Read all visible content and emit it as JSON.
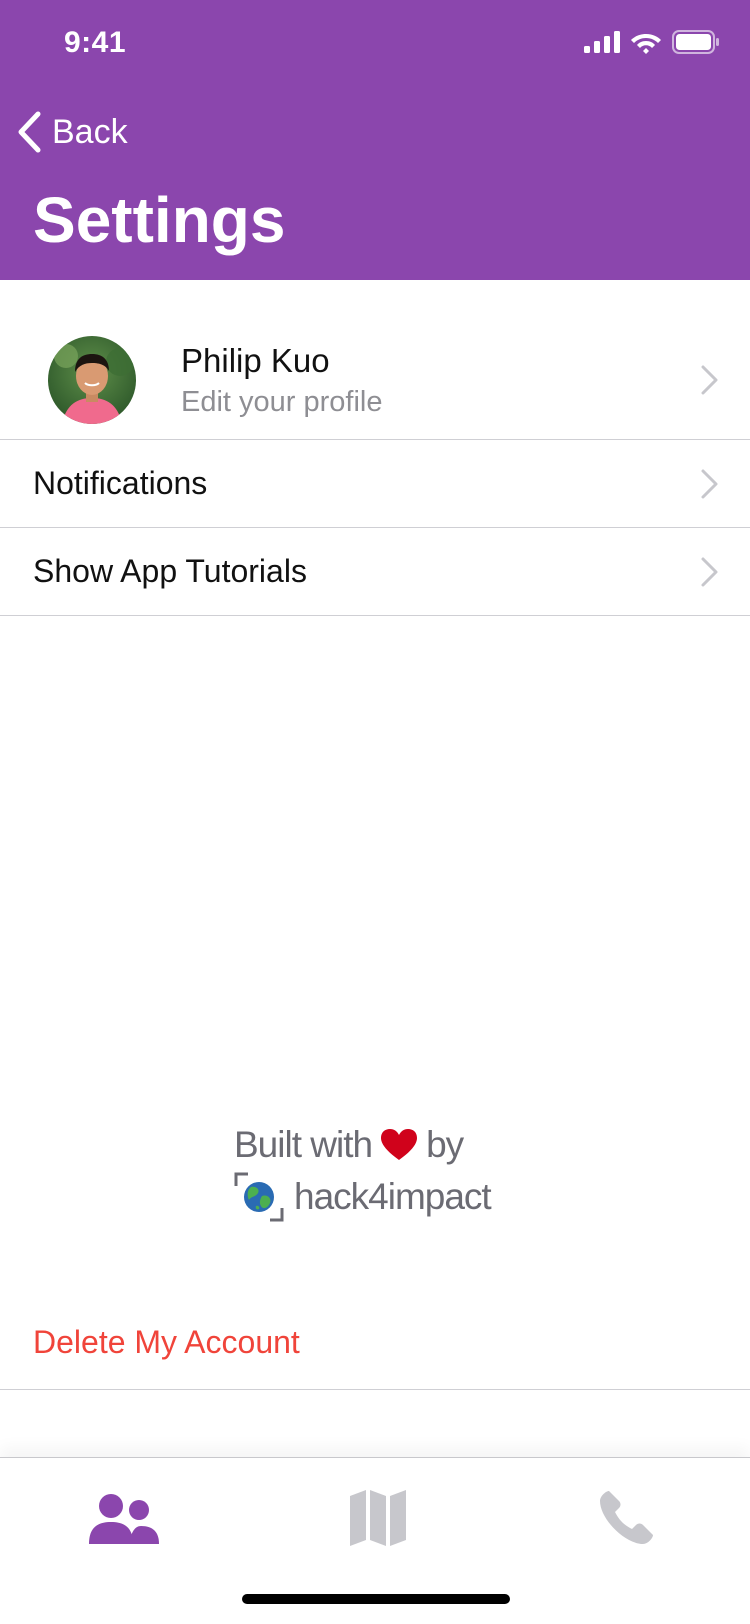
{
  "status_bar": {
    "time": "9:41"
  },
  "header": {
    "back_label": "Back",
    "title": "Settings",
    "background": "#8b46ad"
  },
  "profile": {
    "name": "Philip Kuo",
    "subtitle": "Edit your profile"
  },
  "menu": {
    "items": [
      {
        "label": "Notifications"
      },
      {
        "label": "Show App Tutorials"
      }
    ]
  },
  "credit": {
    "prefix": "Built with",
    "suffix": "by",
    "org": "hack4impact",
    "heart_color": "#d0021b"
  },
  "danger": {
    "delete_label": "Delete My Account",
    "color": "#f0443a"
  },
  "tabbar": {
    "tabs": [
      {
        "icon": "people-icon",
        "active": true
      },
      {
        "icon": "map-icon",
        "active": false
      },
      {
        "icon": "phone-icon",
        "active": false
      }
    ],
    "active_color": "#8b46ad",
    "inactive_color": "#c7c7cc"
  }
}
